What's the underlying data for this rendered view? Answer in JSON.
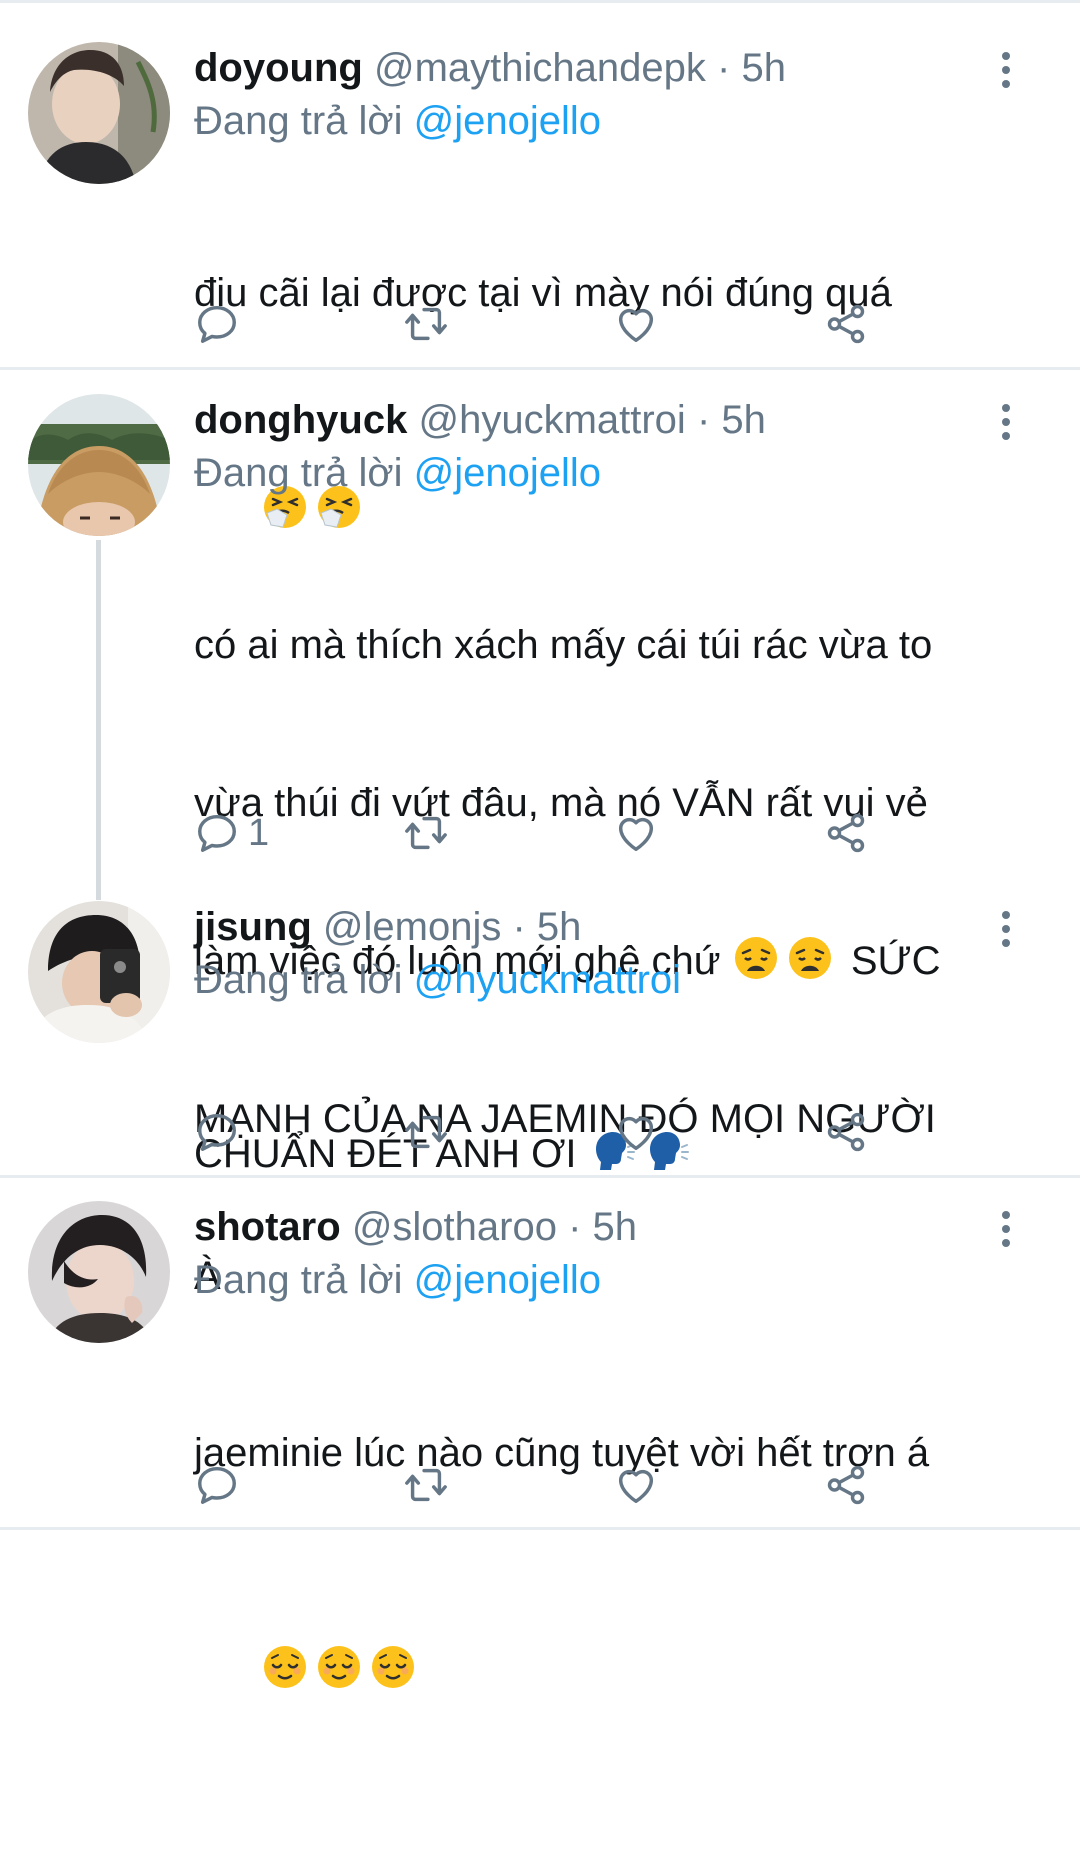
{
  "reply_prefix": "Đang trả lời",
  "tweets": [
    {
      "name": "doyoung",
      "handle": "@maythichandepk",
      "time": "· 5h",
      "reply_to": "@jenojello",
      "line1": "điu cãi lại được tại vì mày nói đúng quá",
      "emoji_line": "😤😤",
      "reply_count": ""
    },
    {
      "name": "donghyuck",
      "handle": "@hyuckmattroi",
      "time": "· 5h",
      "reply_to": "@jenojello",
      "l1": "có ai mà thích xách mấy cái túi rác vừa to",
      "l2": "vừa thúi đi vứt đâu, mà nó VẪN rất vui vẻ",
      "l3a": "làm việc đó luôn mới ghê chứ ",
      "l3b": " SỨC",
      "l4": "MẠNH CỦA NA JAEMIN ĐÓ MỌI NGƯỜI",
      "l5": "À",
      "reply_count": "1"
    },
    {
      "name": "jisung",
      "handle": "@lemonjs",
      "time": "· 5h",
      "reply_to": "@hyuckmattroi",
      "l1": "CHUẨN ĐÉT ANH ƠI ",
      "reply_count": ""
    },
    {
      "name": "shotaro",
      "handle": "@slotharoo",
      "time": "· 5h",
      "reply_to": "@jenojello",
      "l1": "jaeminie lúc nào cũng tuyệt vời hết trơn á",
      "reply_count": ""
    }
  ],
  "icons": {
    "reply": "reply-icon",
    "retweet": "retweet-icon",
    "like": "heart-icon",
    "share": "share-icon",
    "more": "more-vertical-icon"
  },
  "colors": {
    "name": "#14171a",
    "meta": "#657786",
    "mention": "#1da1f2",
    "divider": "#e6ecf0"
  }
}
